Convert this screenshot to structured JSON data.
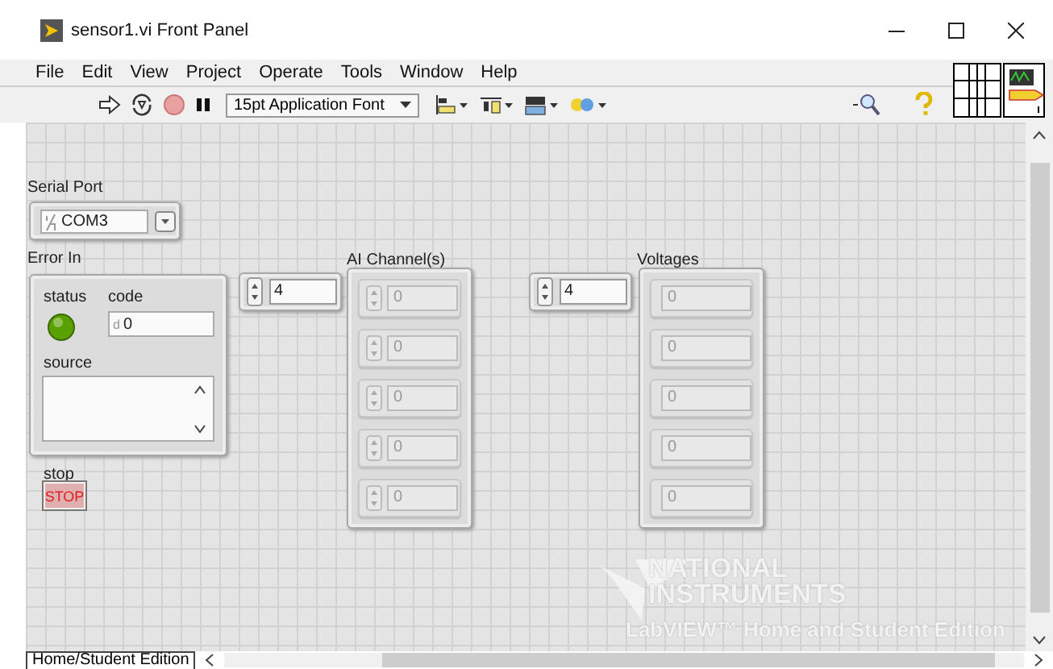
{
  "window": {
    "title": "sensor1.vi Front Panel"
  },
  "menu": [
    "File",
    "Edit",
    "View",
    "Project",
    "Operate",
    "Tools",
    "Window",
    "Help"
  ],
  "toolbar": {
    "font": "15pt Application Font"
  },
  "serial_port": {
    "label": "Serial Port",
    "value": "COM3"
  },
  "error_in": {
    "label": "Error In",
    "status_label": "status",
    "status": false,
    "code_label": "code",
    "radix": "d",
    "code": "0",
    "source_label": "source"
  },
  "stop": {
    "label": "stop",
    "button": "STOP"
  },
  "arrays": [
    {
      "label": "AI Channel(s)",
      "index": "4",
      "kind": "control",
      "elements": [
        "0",
        "0",
        "0",
        "0",
        "0"
      ]
    },
    {
      "label": "Voltages",
      "index": "4",
      "kind": "indicator",
      "elements": [
        "0",
        "0",
        "0",
        "0",
        "0"
      ]
    }
  ],
  "watermark": {
    "line_1": "NATIONAL",
    "line_2": "INSTRUMENTS",
    "line_3": "LabVIEW™ Home and Student Edition"
  },
  "status_bar": {
    "tab": "Home/Student Edition"
  }
}
